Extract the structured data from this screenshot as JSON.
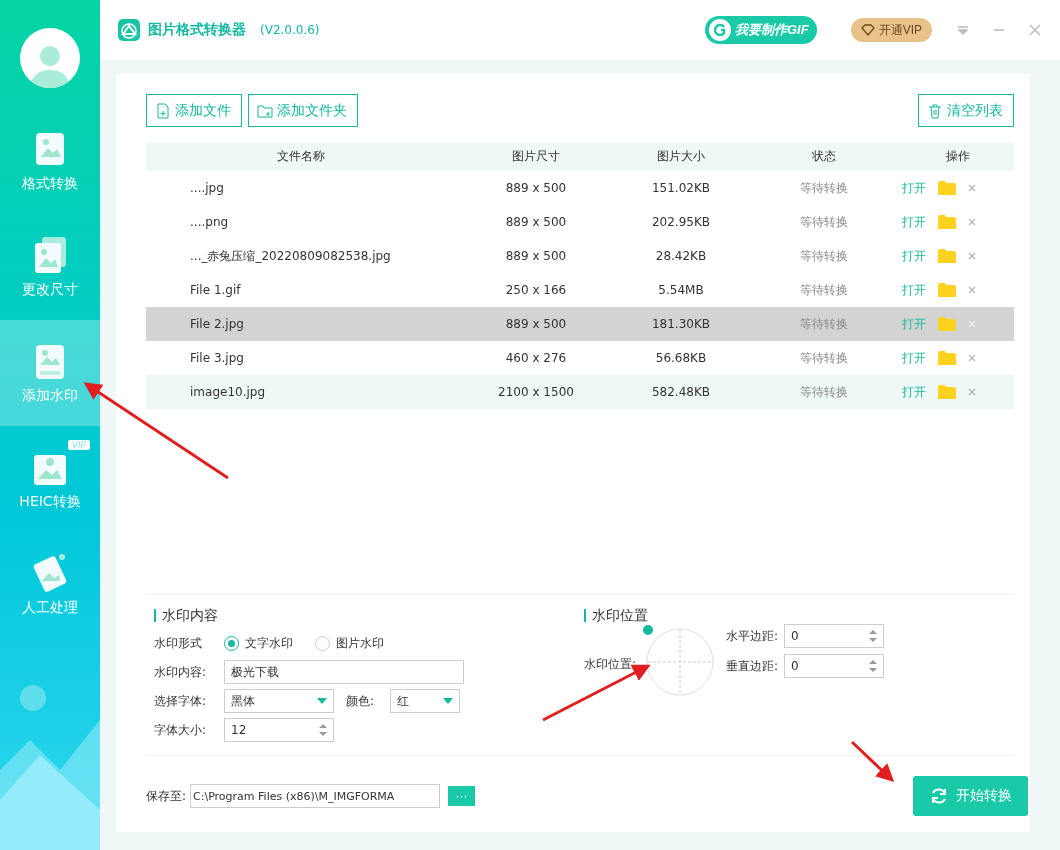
{
  "sidebar": {
    "items": [
      {
        "label": "格式转换",
        "selected": false
      },
      {
        "label": "更改尺寸",
        "selected": false
      },
      {
        "label": "添加水印",
        "selected": true
      },
      {
        "label": "HEIC转换",
        "selected": false,
        "badge": "VIP"
      },
      {
        "label": "人工处理",
        "selected": false
      }
    ]
  },
  "window": {
    "title": "图片格式转换器",
    "version": "(V2.0.0.6)"
  },
  "header": {
    "gif_button": "我要制作GIF",
    "vip_button": "开通VIP"
  },
  "toolbar": {
    "buttons": [
      {
        "label": "添加文件"
      },
      {
        "label": "添加文件夹"
      }
    ],
    "clear_button": "清空列表"
  },
  "table": {
    "columns": [
      "文件名称",
      "图片尺寸",
      "图片大小",
      "状态",
      "操作"
    ],
    "rows": [
      {
        "name": "....jpg",
        "dimensions": "889 x 500",
        "size": "151.02KB",
        "status": "等待转换",
        "open": "打开",
        "selected": false,
        "hovered": false
      },
      {
        "name": "....png",
        "dimensions": "889 x 500",
        "size": "202.95KB",
        "status": "等待转换",
        "open": "打开",
        "selected": false,
        "hovered": false
      },
      {
        "name": "..._赤兔压缩_20220809082538.jpg",
        "dimensions": "889 x 500",
        "size": "28.42KB",
        "status": "等待转换",
        "open": "打开",
        "selected": false,
        "hovered": false
      },
      {
        "name": "File 1.gif",
        "dimensions": "250 x 166",
        "size": "5.54MB",
        "status": "等待转换",
        "open": "打开",
        "selected": false,
        "hovered": false
      },
      {
        "name": "File 2.jpg",
        "dimensions": "889 x 500",
        "size": "181.30KB",
        "status": "等待转换",
        "open": "打开",
        "selected": true,
        "hovered": false
      },
      {
        "name": "File 3.jpg",
        "dimensions": "460 x 276",
        "size": "56.68KB",
        "status": "等待转换",
        "open": "打开",
        "selected": false,
        "hovered": false
      },
      {
        "name": "image10.jpg",
        "dimensions": "2100 x 1500",
        "size": "582.48KB",
        "status": "等待转换",
        "open": "打开",
        "selected": false,
        "hovered": true
      }
    ]
  },
  "watermark_content": {
    "title": "水印内容",
    "type_label": "水印形式",
    "type_options": [
      {
        "label": "文字水印",
        "selected": true
      },
      {
        "label": "图片水印",
        "selected": false
      }
    ],
    "content_label": "水印内容:",
    "content_value": "极光下载",
    "font_label": "选择字体:",
    "font_value": "黑体",
    "color_label": "颜色:",
    "color_value": "红",
    "size_label": "字体大小:",
    "size_value": "12"
  },
  "watermark_position": {
    "title": "水印位置",
    "position_label": "水印位置:",
    "h_margin_label": "水平边距:",
    "h_margin_value": "0",
    "v_margin_label": "垂直边距:",
    "v_margin_value": "0"
  },
  "footer": {
    "save_label": "保存至:",
    "save_path": "C:\\Program Files (x86)\\M_IMGFORMA",
    "browse_button": "···",
    "start_button": "开始转换"
  }
}
